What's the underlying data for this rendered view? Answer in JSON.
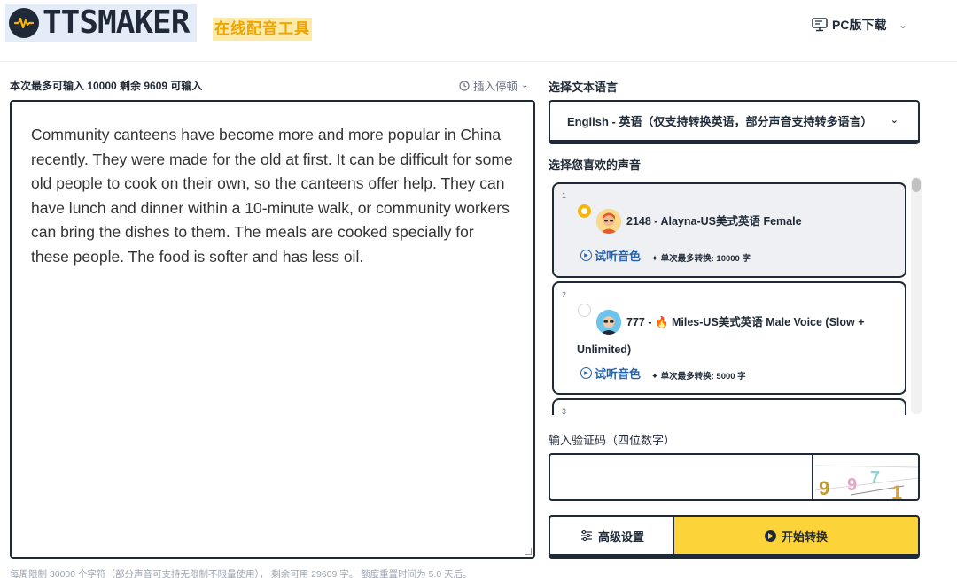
{
  "header": {
    "logo_text": "TTSMAKER",
    "slogan": "在线配音工具",
    "pc_download": "PC版下载"
  },
  "editor": {
    "info": "本次最多可输入 10000 剩余 9609 可输入",
    "insert_pause": "插入停顿",
    "text": "Community canteens have become more and more popular in China recently. They were made for the old at first. It can be difficult for some old people to cook on their own, so the canteens offer help. They can have lunch and dinner within a 10-minute walk, or community workers can bring the dishes to them. The meals are cooked specially for these people. The food is softer and has less oil.",
    "footnote": "每周限制 30000 个字符（部分声音可支持无限制不限量使用）， 剩余可用 29609 字。 额度重置时间为 5.0 天后。"
  },
  "language": {
    "label": "选择文本语言",
    "selected": "English - 英语（仅支持转换英语，部分声音支持转多语言）"
  },
  "voices": {
    "label": "选择您喜欢的声音",
    "items": [
      {
        "index": "1",
        "name": "2148 - Alayna-US美式英语 Female",
        "listen": "试听音色",
        "limit": "单次最多转换: 10000 字",
        "selected": true
      },
      {
        "index": "2",
        "name": "777 - 🔥 Miles-US美式英语 Male Voice (Slow + Unlimited)",
        "listen": "试听音色",
        "limit": "单次最多转换: 5000 字",
        "selected": false
      },
      {
        "index": "3"
      }
    ]
  },
  "captcha": {
    "label": "输入验证码（四位数字）",
    "value": "",
    "digits": "9971"
  },
  "actions": {
    "advanced": "高级设置",
    "start": "开始转换"
  },
  "colors": {
    "accent_yellow": "#fdd33a",
    "link_blue": "#2563b0",
    "border_dark": "#1f2937",
    "slogan_orange": "#f0a400"
  }
}
